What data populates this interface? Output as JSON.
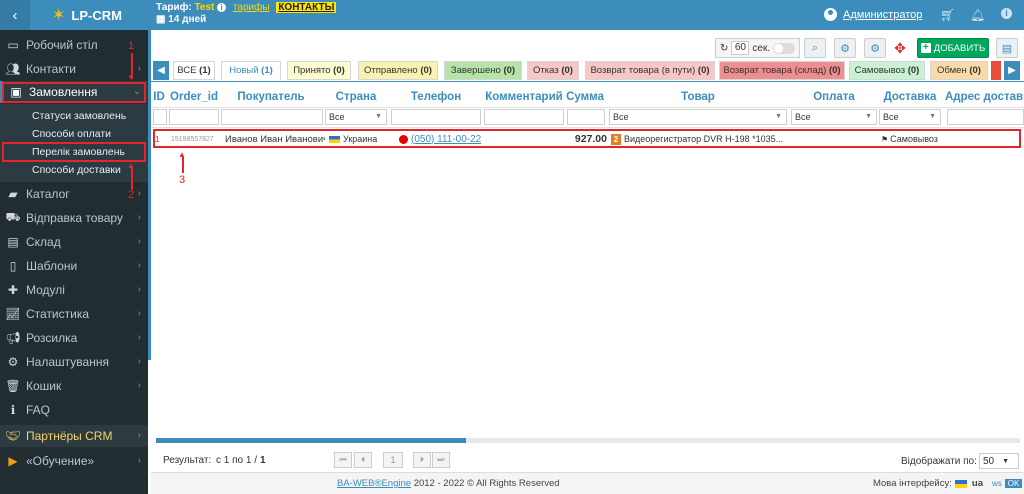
{
  "header": {
    "back_icon": "chevron-left",
    "logo": "LP-CRM",
    "tariff_label": "Тариф:",
    "tariff_name": "Test",
    "tariffs_link": "тарифы",
    "contacts_link": "КОНТАКТЫ",
    "days_left": "14 дней",
    "admin": "Администратор"
  },
  "sidebar": {
    "items": [
      {
        "label": "Робочий стіл",
        "icon": "monitor-icon"
      },
      {
        "label": "Контакти",
        "icon": "users-icon"
      },
      {
        "label": "Замовлення",
        "icon": "money-icon"
      },
      {
        "label": "Каталог",
        "icon": "box-icon"
      },
      {
        "label": "Відправка товару",
        "icon": "truck-icon"
      },
      {
        "label": "Склад",
        "icon": "archive-icon"
      },
      {
        "label": "Шаблони",
        "icon": "file-icon"
      },
      {
        "label": "Модулі",
        "icon": "puzzle-icon"
      },
      {
        "label": "Статистика",
        "icon": "chart-icon"
      },
      {
        "label": "Розсилка",
        "icon": "bullhorn-icon"
      },
      {
        "label": "Налаштування",
        "icon": "gear-icon"
      },
      {
        "label": "Кошик",
        "icon": "trash-icon"
      },
      {
        "label": "FAQ",
        "icon": "info-icon"
      },
      {
        "label": "Партнёры CRM",
        "icon": "handshake-icon"
      },
      {
        "label": "«Обучение»",
        "icon": "video-icon"
      }
    ],
    "sub": [
      {
        "label": "Статуси замовлень"
      },
      {
        "label": "Способи оплати"
      },
      {
        "label": "Перелік замовлень"
      },
      {
        "label": "Способи доставки"
      }
    ],
    "annotations": [
      "1",
      "2",
      "3"
    ]
  },
  "toolbar": {
    "refresh_value": "60",
    "refresh_unit": "сек.",
    "add_label": "ДОБАВИТЬ"
  },
  "tabs": [
    {
      "label": "ВСЕ",
      "count": "(1)",
      "bg": "#ffffff"
    },
    {
      "label": "Новый",
      "count": "(1)",
      "bg": "#ffffff"
    },
    {
      "label": "Принято",
      "count": "(0)",
      "bg": "#fdfbd0"
    },
    {
      "label": "Отправлено",
      "count": "(0)",
      "bg": "#f8f2b0"
    },
    {
      "label": "Завершено",
      "count": "(0)",
      "bg": "#b6e3a8"
    },
    {
      "label": "Отказ",
      "count": "(0)",
      "bg": "#f7c7c7"
    },
    {
      "label": "Возврат товара (в пути)",
      "count": "(0)",
      "bg": "#f7c7c7"
    },
    {
      "label": "Возврат товара (склад)",
      "count": "(0)",
      "bg": "#ee8e8e"
    },
    {
      "label": "Самовывоз",
      "count": "(0)",
      "bg": "#c9f1d4"
    },
    {
      "label": "Обмен",
      "count": "(0)",
      "bg": "#fbd9a8"
    }
  ],
  "columns": [
    "ID",
    "Order_id",
    "Покупатель",
    "Страна",
    "Телефон",
    "Комментарий",
    "Сумма",
    "Товар",
    "Оплата",
    "Доставка",
    "Адрес доставки"
  ],
  "filters": {
    "all": "Все"
  },
  "orders": [
    {
      "id": "1",
      "order_id": "15198557827",
      "customer": "Иванов Иван Иванович",
      "country": "Украина",
      "phone": "(050) 111-00-22",
      "comment": "",
      "sum": "927.00",
      "product_qty": "2",
      "product": "Видеорегистратор DVR H-198 *1035...",
      "payment": "",
      "delivery": "Самовывоз",
      "address": ""
    }
  ],
  "footer": {
    "result_label": "Результат:",
    "result_range": "с 1 по 1 /",
    "result_total": "1",
    "page": "1",
    "per_page_label": "Відображати по:",
    "per_page": "50",
    "copyright_brand": "BA-WEB®Engine",
    "copyright_text": "2012 - 2022 © All Rights Reserved",
    "lang_label": "Мова інтерфейсу:",
    "lang_ua": "ua",
    "lang_ws": "ws",
    "lang_ok": "OK"
  },
  "colors": {
    "header": "#3c8dbc",
    "sidebar": "#222d32",
    "highlight": "#e5242b",
    "add": "#00a65a"
  }
}
